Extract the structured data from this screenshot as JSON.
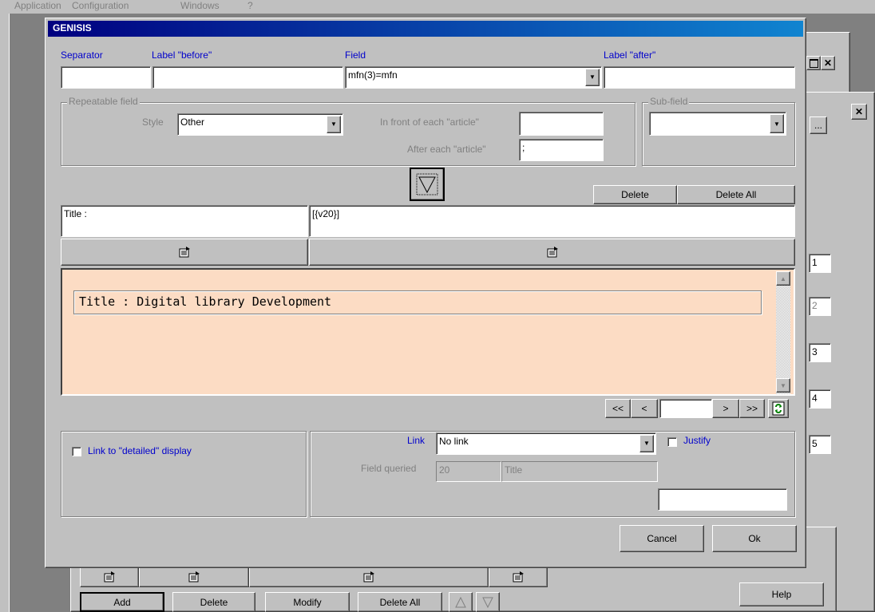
{
  "menubar": {
    "application": "Application",
    "configuration": "Configuration",
    "windows": "Windows",
    "help": "?"
  },
  "dialog": {
    "title": "GENISIS",
    "labels": {
      "separator": "Separator",
      "label_before": "Label \"before\"",
      "field": "Field",
      "label_after": "Label \"after\""
    },
    "field_value": "mfn(3)=mfn",
    "repeatable": {
      "group_label": "Repeatable field",
      "style_label": "Style",
      "style_value": "Other",
      "in_front_label": "In front of each \"article\"",
      "after_label": "After each \"article\"",
      "after_value": ";"
    },
    "subfield": {
      "group_label": "Sub-field"
    },
    "delete_label": "Delete",
    "delete_all_label": "Delete All",
    "title_cell": "Title :",
    "value_cell": "[{v20}]",
    "preview_text": "Title : Digital library Development",
    "nav": {
      "first": "<<",
      "prev": "<",
      "next": ">",
      "last": ">>"
    },
    "link_detailed_label": "Link to \"detailed\" display",
    "link_label": "Link",
    "link_value": "No link",
    "justify_label": "Justify",
    "field_queried_label": "Field queried",
    "field_queried_num": "20",
    "field_queried_name": "Title",
    "cancel_label": "Cancel",
    "ok_label": "Ok"
  },
  "background": {
    "add_label": "Add",
    "delete_label": "Delete",
    "modify_label": "Modify",
    "delete_all_label": "Delete All",
    "help_label": "Help",
    "ellipsis_label": "...",
    "numbers": [
      "1",
      "2",
      "3",
      "4",
      "5"
    ]
  }
}
